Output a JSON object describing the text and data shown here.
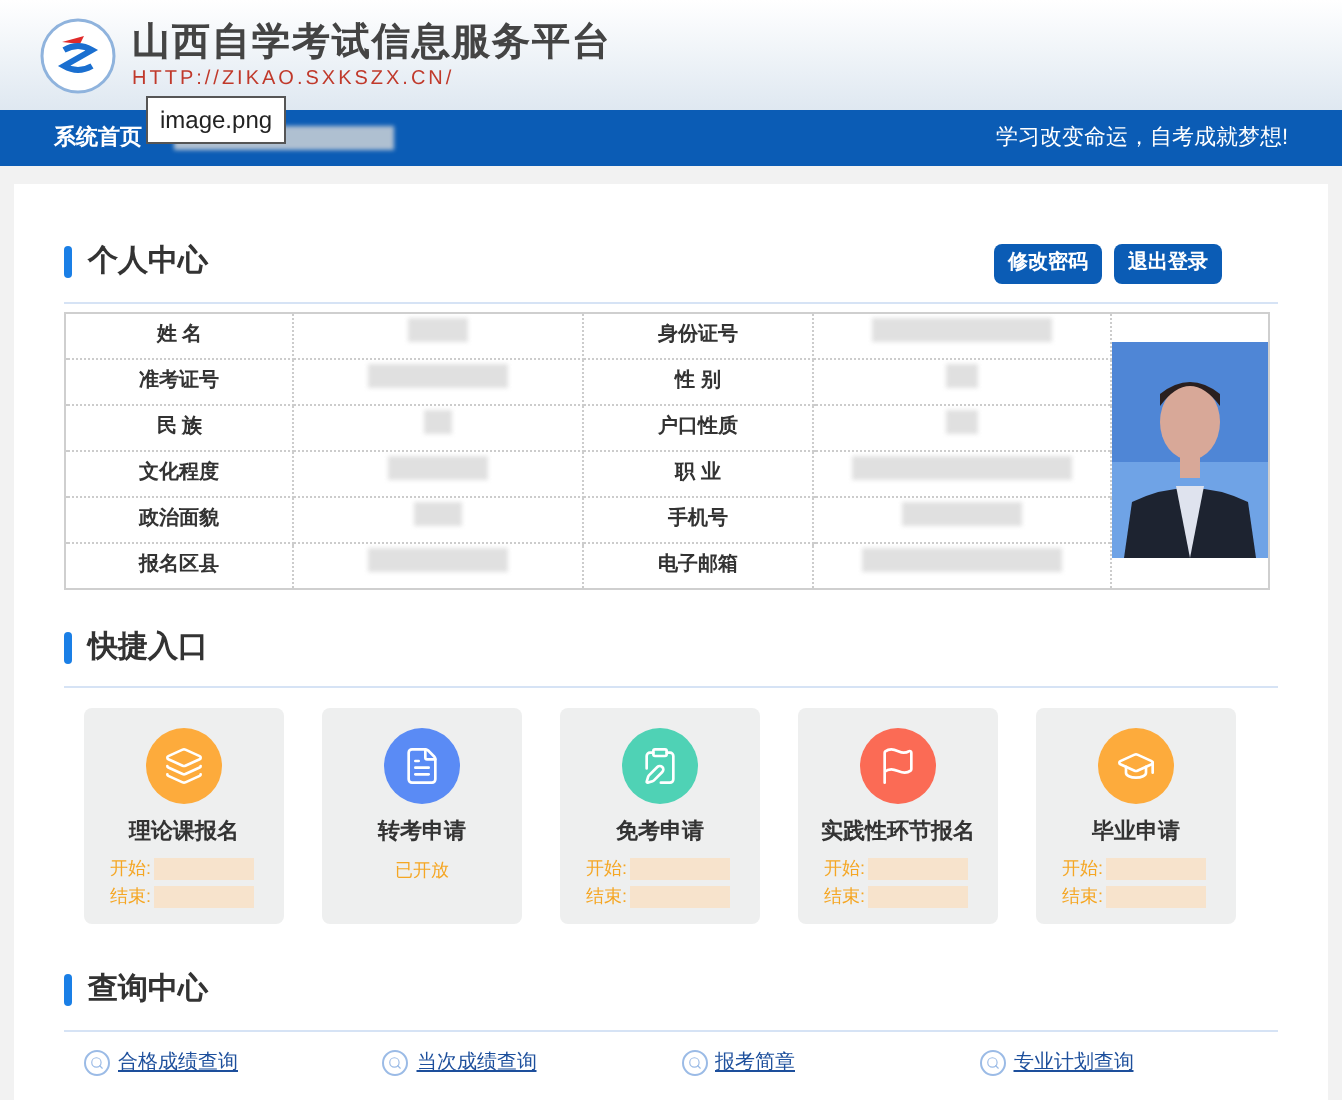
{
  "header": {
    "title": "山西自学考试信息服务平台",
    "url": "HTTP://ZIKAO.SXKSZX.CN/"
  },
  "nav": {
    "home": "系统首页",
    "slogan": "学习改变命运，自考成就梦想!"
  },
  "tooltip": "image.png",
  "profile": {
    "title": "个人中心",
    "buttons": [
      "修改密码",
      "退出登录"
    ],
    "rows": [
      [
        "姓 名",
        "身份证号"
      ],
      [
        "准考证号",
        "性 别"
      ],
      [
        "民 族",
        "户口性质"
      ],
      [
        "文化程度",
        "职 业"
      ],
      [
        "政治面貌",
        "手机号"
      ],
      [
        "报名区县",
        "电子邮箱"
      ]
    ]
  },
  "quick": {
    "title": "快捷入口",
    "items": [
      {
        "title": "理论课报名",
        "kind": "dates",
        "color": "#fdab3c",
        "start": "开始:",
        "end": "结束:"
      },
      {
        "title": "转考申请",
        "kind": "status",
        "color": "#5a8bf5",
        "status": "已开放"
      },
      {
        "title": "免考申请",
        "kind": "dates",
        "color": "#4fd2b5",
        "start": "开始:",
        "end": "结束:"
      },
      {
        "title": "实践性环节报名",
        "kind": "dates",
        "color": "#fb6b55",
        "start": "开始:",
        "end": "结束:"
      },
      {
        "title": "毕业申请",
        "kind": "dates",
        "color": "#fdab3c",
        "start": "开始:",
        "end": "结束:"
      }
    ]
  },
  "query": {
    "title": "查询中心",
    "links": [
      "合格成绩查询",
      "当次成绩查询",
      "报考简章",
      "专业计划查询"
    ]
  }
}
